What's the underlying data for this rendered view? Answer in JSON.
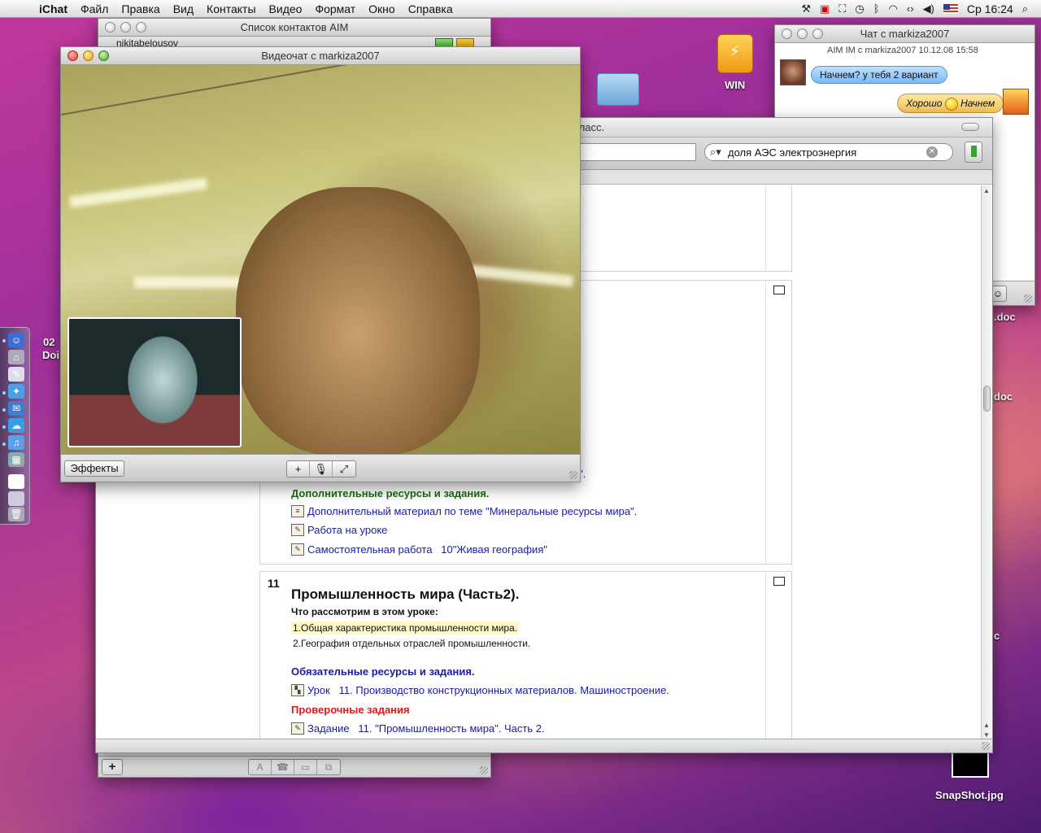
{
  "menubar": {
    "apple_icon": "apple-logo-icon",
    "items": [
      "iChat",
      "Файл",
      "Правка",
      "Вид",
      "Контакты",
      "Видео",
      "Формат",
      "Окно",
      "Справка"
    ],
    "clock": "Ср 16:24"
  },
  "aim_window": {
    "title": "Список контактов AIM",
    "username": "nikitabelousov",
    "add_label": "+",
    "toolbar_icons": [
      "A",
      "☎",
      "▭",
      "⧉"
    ]
  },
  "video_window": {
    "title": "Видеочат с markiza2007",
    "effects_label": "Эффекты",
    "controls": [
      "+",
      "🎙",
      "⤢"
    ]
  },
  "chat_window": {
    "title": "Чат с markiza2007",
    "meta": "AIM IM с markiza2007  10.12.08 15:58",
    "msg_in": "Начнем? у тебя 2 вариант",
    "msg_out_a": "Хорошо",
    "msg_out_b": "Начнем",
    "emoticon_label": "☺"
  },
  "browser": {
    "title": "ография мира. 10 класс.",
    "search_value": "доля АЭС электроэнергия",
    "partial_link": "ов\".",
    "section10": {
      "extra_heading": "Дополнительные ресурсы и задания.",
      "items": [
        "Дополнительный материал по теме \"Минеральные ресурсы мира\".",
        "Работа на уроке",
        "Самостоятельная работа    10\"Живая география\""
      ]
    },
    "section11": {
      "number": "11",
      "title": "Промышленность мира (Часть2).",
      "subtitle": "Что рассмотрим в этом уроке:",
      "points": [
        "1.Общая характеристика промышленности мира.",
        "2.География отдельных отраслей промышленности."
      ],
      "required_heading": "Обязательные ресурсы и задания.",
      "lesson_link": "Урок    11. Производство конструкционных материалов. Машиностроение.",
      "tests_heading": "Проверочные задания",
      "task_link": "Задание    11. \"Промышленность мира\". Часть 2."
    }
  },
  "desktop": {
    "usb_label": "WIN",
    "snapshot_label": "SnapShot.jpg",
    "doc1": ".doc",
    "doc2": "doc",
    "doc3": "c",
    "left_label_a": "02",
    "left_label_b": "Doi"
  },
  "colors": {
    "link_blue": "#1a1aa8",
    "heading_green": "#1b6b12",
    "heading_red": "#e0161a"
  }
}
